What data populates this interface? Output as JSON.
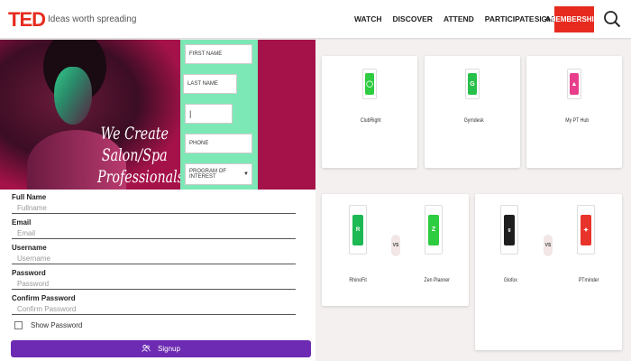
{
  "header": {
    "logo": "TED",
    "tagline": "Ideas worth spreading",
    "nav": [
      "WATCH",
      "DISCOVER",
      "ATTEND",
      "PARTICIPATE",
      "ABOUT"
    ],
    "signin": "SIGN IN",
    "membership": "MEMBERSHIP",
    "search_icon": "search-icon"
  },
  "banner": {
    "headline_lines": [
      "We Create",
      "Salon/Spa",
      "Professionals"
    ],
    "form": {
      "first_name": "FIRST NAME",
      "last_name": "LAST NAME",
      "email_value": "",
      "phone": "PHONE",
      "program": "PROGRAM OF INTEREST"
    },
    "colors": {
      "background": "#a5124a",
      "form_background": "#7ce8b6"
    }
  },
  "signup": {
    "fields": [
      {
        "label": "Full Name",
        "placeholder": "Fullname"
      },
      {
        "label": "Email",
        "placeholder": "Email"
      },
      {
        "label": "Username",
        "placeholder": "Username"
      },
      {
        "label": "Password",
        "placeholder": "Password"
      },
      {
        "label": "Confirm Password",
        "placeholder": "Confirm Password"
      }
    ],
    "show_password": "Show Password",
    "button": "Signup",
    "button_icon": "user-group-icon",
    "button_color": "#6d2bb3"
  },
  "apps": {
    "top": [
      {
        "name": "ClubRight",
        "color": "#2ecc40"
      },
      {
        "name": "Gymdesk",
        "color": "#27c04a"
      },
      {
        "name": "My PT Hub",
        "color": "#e83e8c"
      }
    ],
    "comparisons": [
      {
        "left": "RhinoFit",
        "right": "Zen Planner",
        "vs": "VS"
      },
      {
        "left": "Glofox",
        "right": "PTminder",
        "vs": "VS"
      }
    ]
  }
}
